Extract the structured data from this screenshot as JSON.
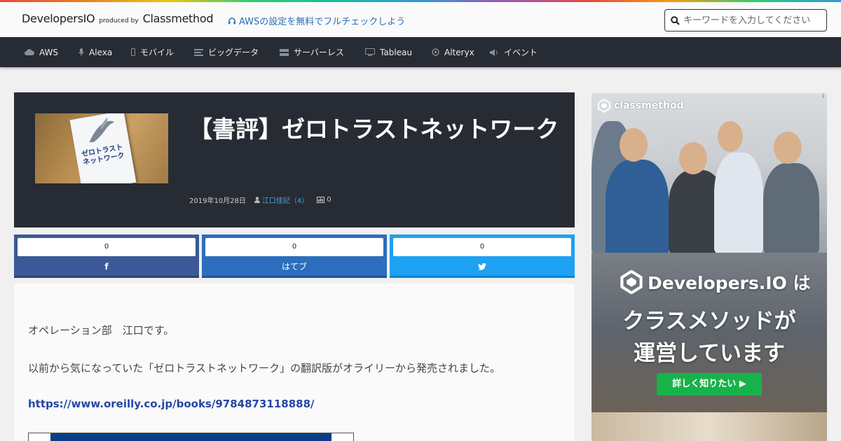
{
  "header": {
    "brand": "DevelopersIO",
    "produced_by": "produced by",
    "company": "Classmethod",
    "promo_text": "AWSの設定を無料でフルチェックしよう",
    "search_placeholder": "キーワードを入力してください"
  },
  "nav": {
    "items": [
      {
        "label": "AWS",
        "icon": "cloud-icon"
      },
      {
        "label": "Alexa",
        "icon": "microphone-icon"
      },
      {
        "label": "モバイル",
        "icon": "mobile-icon"
      },
      {
        "label": "ビッグデータ",
        "icon": "list-icon"
      },
      {
        "label": "サーバーレス",
        "icon": "server-icon"
      },
      {
        "label": "Tableau",
        "icon": "monitor-icon"
      },
      {
        "label": "Alteryx",
        "icon": "circle-icon"
      },
      {
        "label": "イベント",
        "icon": "volume-icon"
      }
    ]
  },
  "article": {
    "title": "【書評】ゼロトラストネットワーク",
    "date": "2019年10月28日",
    "author": "江口佳記（4）",
    "hatena_count": "0",
    "thumbnail_text": "ゼロトラスト\nネットワーク",
    "paragraphs": [
      "オペレーション部　江口です。",
      "以前から気になっていた「ゼロトラストネットワーク」の翻訳版がオライリーから発売されました。"
    ],
    "link": "https://www.oreilly.co.jp/books/9784873118888/"
  },
  "share": {
    "facebook": {
      "count": "0",
      "label": "f",
      "color": "#3b5998"
    },
    "hatena": {
      "count": "0",
      "label": "はてブ",
      "color": "#2c6ebd"
    },
    "twitter": {
      "count": "0",
      "label": "twitter",
      "color": "#1da1f2"
    }
  },
  "ad": {
    "brand": "classmethod",
    "info": "i",
    "line1": "Developers.IO は",
    "line2": "クラスメソッドが",
    "line3": "運営しています",
    "cta": "詳しく知りたい ▶"
  },
  "colors": {
    "navbar": "#272b33",
    "link": "#2646a3",
    "cta_green": "#17b34a"
  }
}
